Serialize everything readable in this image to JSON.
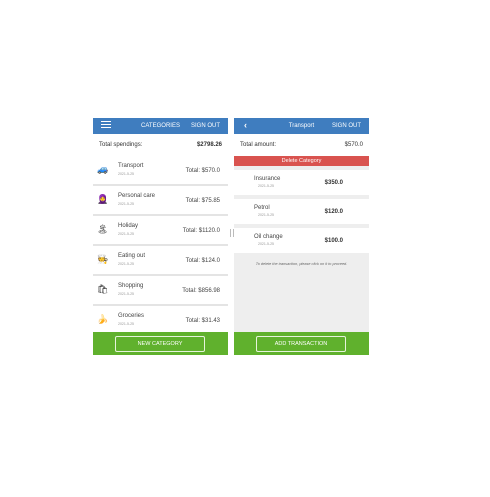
{
  "left": {
    "title": "CATEGORIES",
    "signout": "SIGN OUT",
    "total_label": "Total spendings:",
    "total_value": "$2798.26",
    "categories": [
      {
        "icon": "car-icon",
        "glyph": "🚙",
        "name": "Transport",
        "date": "2021-5-25",
        "total": "Total: $570.0"
      },
      {
        "icon": "person-icon",
        "glyph": "🧕",
        "name": "Personal care",
        "date": "2021-5-25",
        "total": "Total: $75.85"
      },
      {
        "icon": "palm-tree-icon",
        "glyph": "🏝",
        "name": "Holiday",
        "date": "2021-5-25",
        "total": "Total: $1120.0"
      },
      {
        "icon": "eating-icon",
        "glyph": "🧑‍🍳",
        "name": "Eating out",
        "date": "2021-5-25",
        "total": "Total: $124.0"
      },
      {
        "icon": "shopping-bag-icon",
        "glyph": "🛍",
        "name": "Shopping",
        "date": "2021-5-25",
        "total": "Total: $856.98"
      },
      {
        "icon": "banana-icon",
        "glyph": "🍌",
        "name": "Groceries",
        "date": "2021-5-25",
        "total": "Total: $31.43"
      }
    ],
    "button": "NEW CATEGORY"
  },
  "right": {
    "title": "Transport",
    "signout": "SIGN OUT",
    "total_label": "Total amount:",
    "total_value": "$570.0",
    "delete_label": "Delete Category",
    "transactions": [
      {
        "name": "Insurance",
        "date": "2021-5-25",
        "amount": "$350.0"
      },
      {
        "name": "Petrol",
        "date": "2021-5-25",
        "amount": "$120.0"
      },
      {
        "name": "Oil change",
        "date": "2021-5-25",
        "amount": "$100.0"
      }
    ],
    "hint": "To delete the transaction, please click on it to proceed.",
    "button": "ADD TRANSACTION"
  },
  "colors": {
    "header": "#3f7dbf",
    "footer": "#60b12d",
    "delete": "#d9534f"
  }
}
